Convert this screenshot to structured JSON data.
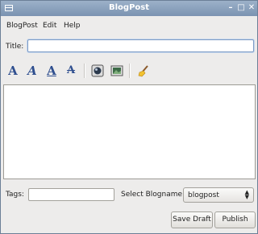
{
  "window": {
    "title": "BlogPost"
  },
  "menubar": {
    "items": [
      "BlogPost",
      "Edit",
      "Help"
    ]
  },
  "post": {
    "title_label": "Title:",
    "title_value": ""
  },
  "toolbar": {
    "bold_glyph": "A",
    "italic_glyph": "A",
    "underline_glyph": "A",
    "strike_glyph": "A",
    "icons": [
      "bold-icon",
      "italic-icon",
      "underline-icon",
      "strikethrough-icon",
      "insert-link-icon",
      "insert-image-icon",
      "clear-format-icon"
    ]
  },
  "editor": {
    "content": ""
  },
  "tags": {
    "label": "Tags:",
    "value": ""
  },
  "blog": {
    "label": "Select Blogname:",
    "selected": "blogpost"
  },
  "actions": {
    "save_draft": "Save Draft",
    "publish": "Publish"
  },
  "colors": {
    "titlebar": "#8aa1bf",
    "window_bg": "#edeceb",
    "format_icon": "#2f4f8f"
  }
}
